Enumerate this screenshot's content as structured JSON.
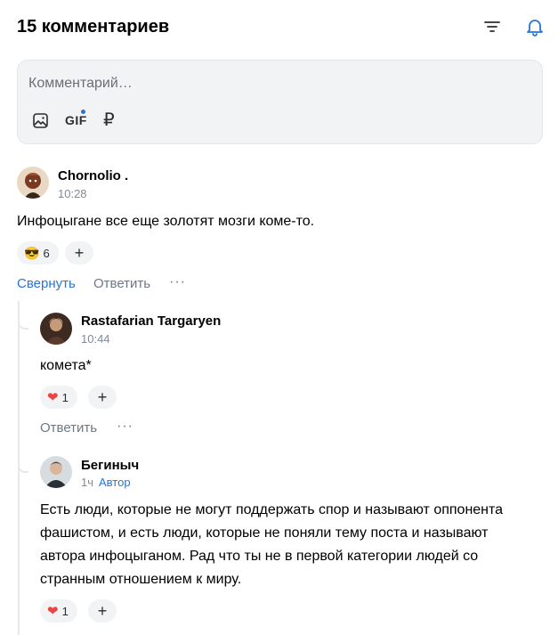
{
  "header": {
    "title": "15 комментариев",
    "sort_icon": "sort-icon",
    "bell_icon": "bell-icon",
    "accent": "#2775d6"
  },
  "composer": {
    "placeholder": "Комментарий…",
    "tools": {
      "image_icon": "image-icon",
      "gif_label": "GIF",
      "ruble_label": "₽"
    }
  },
  "comments": [
    {
      "author": "Chornolio .",
      "time": "10:28",
      "text": "Инфоцыгане все еще золотят мозги коме-то.",
      "reaction": {
        "emoji": "😎",
        "count": "6"
      },
      "actions": {
        "collapse": "Свернуть",
        "reply": "Ответить",
        "more": "···"
      },
      "replies": [
        {
          "author": "Rastafarian Targaryen",
          "time": "10:44",
          "text": "комета*",
          "reaction": {
            "emoji": "❤",
            "count": "1"
          },
          "actions": {
            "reply": "Ответить",
            "more": "···"
          }
        },
        {
          "author": "Бегиныч",
          "time": "1ч",
          "badge": "Автор",
          "text": "Есть люди, которые не могут поддержать спор и называют оппонента фашистом, и есть люди, которые не поняли тему поста и называют автора инфоцыганом. Рад что ты не в первой категории людей со странным отношением к миру.",
          "reaction": {
            "emoji": "❤",
            "count": "1"
          }
        }
      ]
    }
  ]
}
